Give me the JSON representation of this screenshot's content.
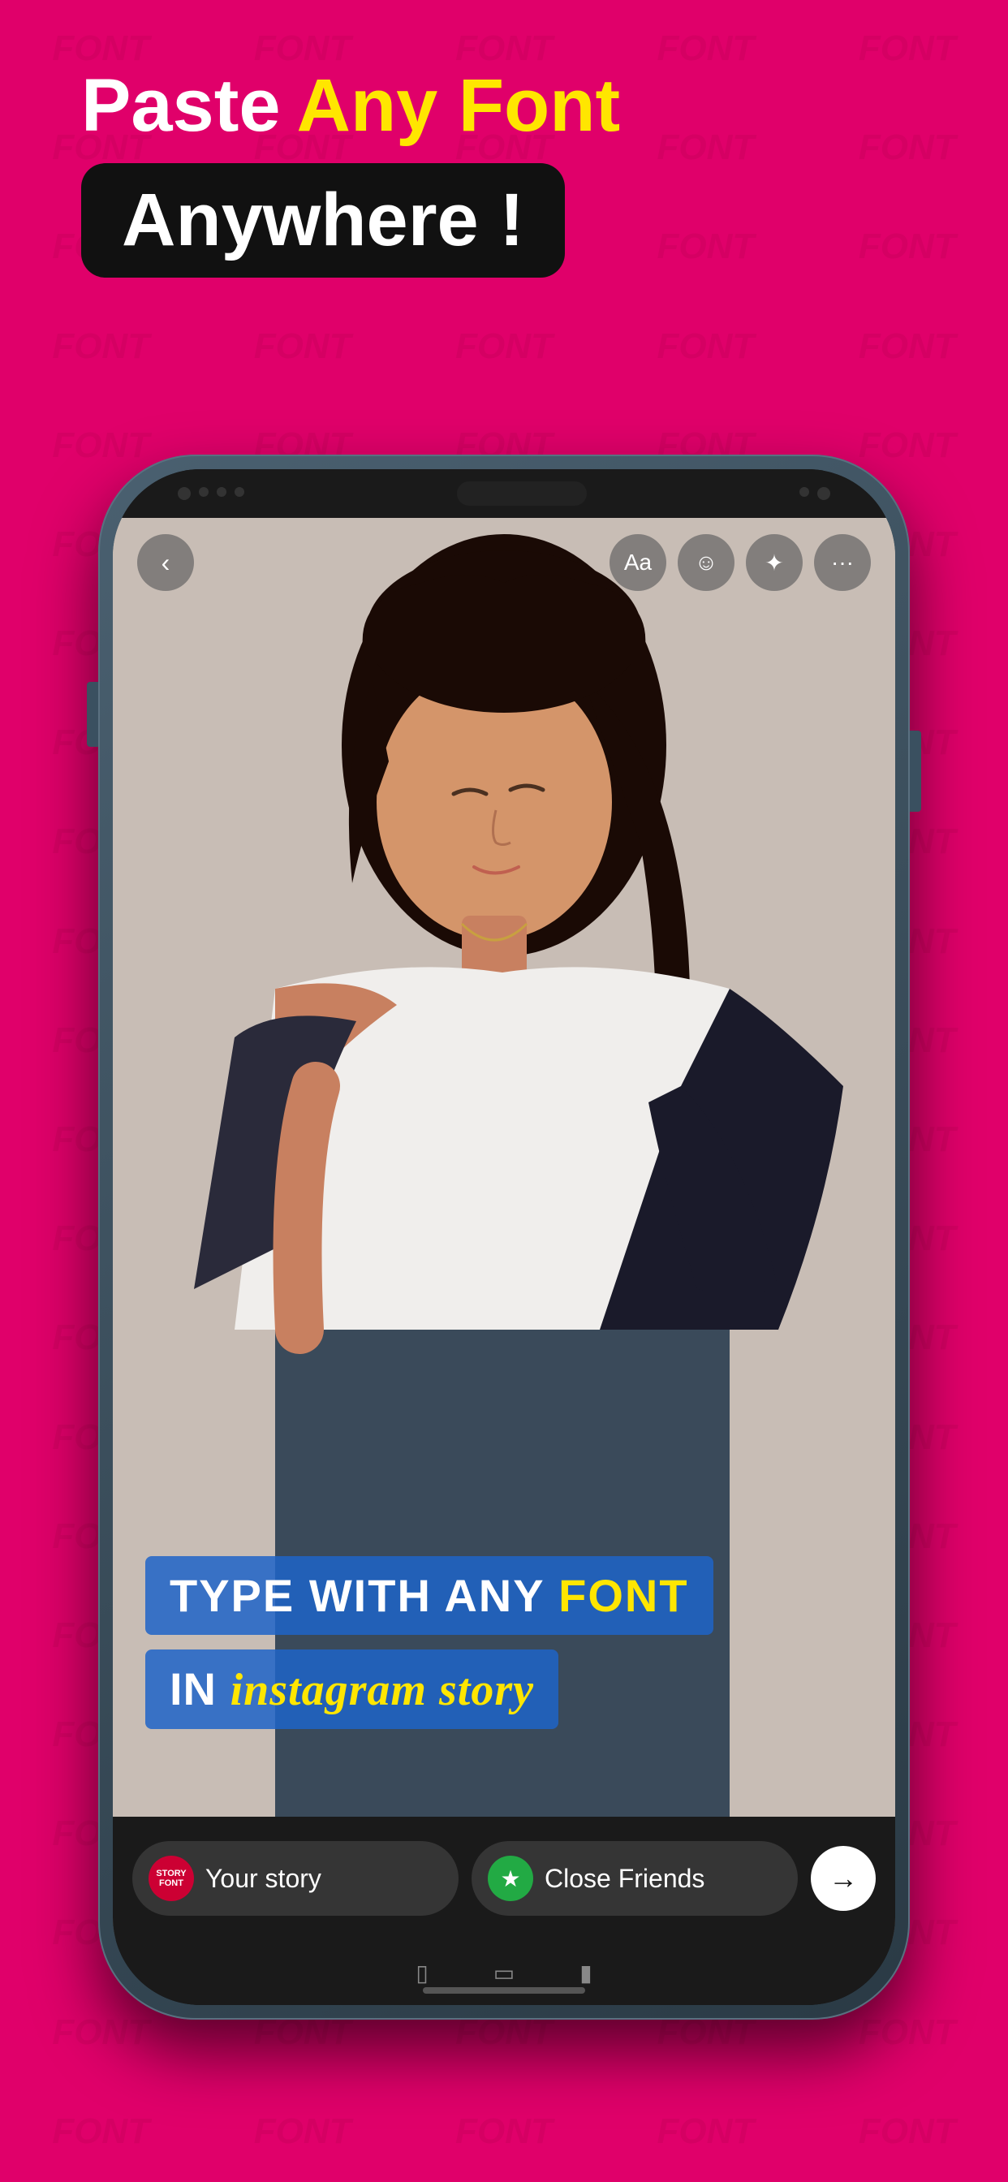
{
  "background_color": "#E0006A",
  "watermark": {
    "text": "FONT"
  },
  "header": {
    "headline_paste": "Paste",
    "headline_any_font": "Any Font",
    "anywhere_text": "Anywhere !"
  },
  "phone": {
    "toolbar": {
      "back_icon": "‹",
      "font_icon_label": "Aa",
      "emoji_icon": "☺",
      "effects_icon": "✦",
      "more_icon": "•••"
    },
    "story_content": {
      "line1_plain": "TYPE WITH ANY",
      "line1_highlight": "FONT",
      "line2_plain": "IN",
      "line2_italic": "instagram story"
    },
    "bottom_bar": {
      "story_font_icon_text": "STORY\nFONT",
      "your_story_label": "Your story",
      "close_friends_label": "Close Friends",
      "next_icon": "→"
    }
  }
}
